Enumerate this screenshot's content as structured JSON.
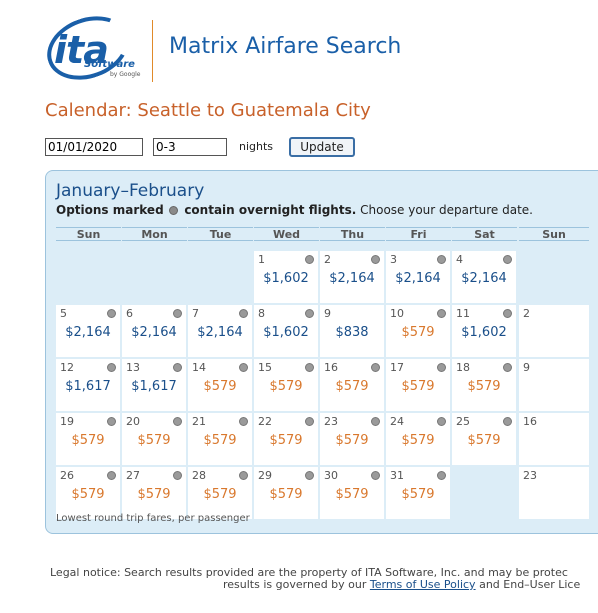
{
  "brand": {
    "logo_text": "ita",
    "logo_sub": "Software",
    "logo_by": "by Google",
    "app_title": "Matrix Airfare Search"
  },
  "page": {
    "heading": "Calendar: Seattle to Guatemala City"
  },
  "form": {
    "date_value": "01/01/2020",
    "nights_value": "0-3",
    "nights_label": "nights",
    "update_label": "Update"
  },
  "calendar": {
    "month_title": "January–February",
    "instructions_bold_1": "Options marked",
    "instructions_bold_2": "contain overnight flights.",
    "instructions_rest": "Choose your departure date.",
    "days_of_week": [
      "Sun",
      "Mon",
      "Tue",
      "Wed",
      "Thu",
      "Fri",
      "Sat"
    ],
    "weeks": [
      [
        null,
        null,
        null,
        {
          "day": "1",
          "price": "$1,602",
          "tone": "blue",
          "overnight": true
        },
        {
          "day": "2",
          "price": "$2,164",
          "tone": "blue",
          "overnight": true
        },
        {
          "day": "3",
          "price": "$2,164",
          "tone": "blue",
          "overnight": true
        },
        {
          "day": "4",
          "price": "$2,164",
          "tone": "blue",
          "overnight": true
        }
      ],
      [
        {
          "day": "5",
          "price": "$2,164",
          "tone": "blue",
          "overnight": true
        },
        {
          "day": "6",
          "price": "$2,164",
          "tone": "blue",
          "overnight": true
        },
        {
          "day": "7",
          "price": "$2,164",
          "tone": "blue",
          "overnight": true
        },
        {
          "day": "8",
          "price": "$1,602",
          "tone": "blue",
          "overnight": true
        },
        {
          "day": "9",
          "price": "$838",
          "tone": "blue",
          "overnight": false
        },
        {
          "day": "10",
          "price": "$579",
          "tone": "orange",
          "overnight": true
        },
        {
          "day": "11",
          "price": "$1,602",
          "tone": "blue",
          "overnight": true
        }
      ],
      [
        {
          "day": "12",
          "price": "$1,617",
          "tone": "blue",
          "overnight": true
        },
        {
          "day": "13",
          "price": "$1,617",
          "tone": "blue",
          "overnight": true
        },
        {
          "day": "14",
          "price": "$579",
          "tone": "orange",
          "overnight": true
        },
        {
          "day": "15",
          "price": "$579",
          "tone": "orange",
          "overnight": true
        },
        {
          "day": "16",
          "price": "$579",
          "tone": "orange",
          "overnight": true
        },
        {
          "day": "17",
          "price": "$579",
          "tone": "orange",
          "overnight": true
        },
        {
          "day": "18",
          "price": "$579",
          "tone": "orange",
          "overnight": true
        }
      ],
      [
        {
          "day": "19",
          "price": "$579",
          "tone": "orange",
          "overnight": true
        },
        {
          "day": "20",
          "price": "$579",
          "tone": "orange",
          "overnight": true
        },
        {
          "day": "21",
          "price": "$579",
          "tone": "orange",
          "overnight": true
        },
        {
          "day": "22",
          "price": "$579",
          "tone": "orange",
          "overnight": true
        },
        {
          "day": "23",
          "price": "$579",
          "tone": "orange",
          "overnight": true
        },
        {
          "day": "24",
          "price": "$579",
          "tone": "orange",
          "overnight": true
        },
        {
          "day": "25",
          "price": "$579",
          "tone": "orange",
          "overnight": true
        }
      ],
      [
        {
          "day": "26",
          "price": "$579",
          "tone": "orange",
          "overnight": true
        },
        {
          "day": "27",
          "price": "$579",
          "tone": "orange",
          "overnight": true
        },
        {
          "day": "28",
          "price": "$579",
          "tone": "orange",
          "overnight": true
        },
        {
          "day": "29",
          "price": "$579",
          "tone": "orange",
          "overnight": true
        },
        {
          "day": "30",
          "price": "$579",
          "tone": "orange",
          "overnight": true
        },
        {
          "day": "31",
          "price": "$579",
          "tone": "orange",
          "overnight": true
        },
        null
      ]
    ],
    "second_month": {
      "dow_label": "Sun",
      "days": [
        "",
        "2",
        "9",
        "16",
        "23"
      ]
    },
    "footnote": "Lowest round trip fares, per passenger"
  },
  "legal": {
    "line1": "Legal notice: Search results provided are the property of ITA Software, Inc. and may be protec",
    "line2_prefix": "results is governed by our ",
    "terms_link": "Terms of Use Policy",
    "line2_suffix": " and End–User Lice"
  },
  "colors": {
    "brand_blue": "#1a5fa8",
    "heading_orange": "#c8612a",
    "price_blue": "#1a4f8a",
    "price_orange": "#d9782d",
    "panel_bg": "#dcedf7"
  }
}
